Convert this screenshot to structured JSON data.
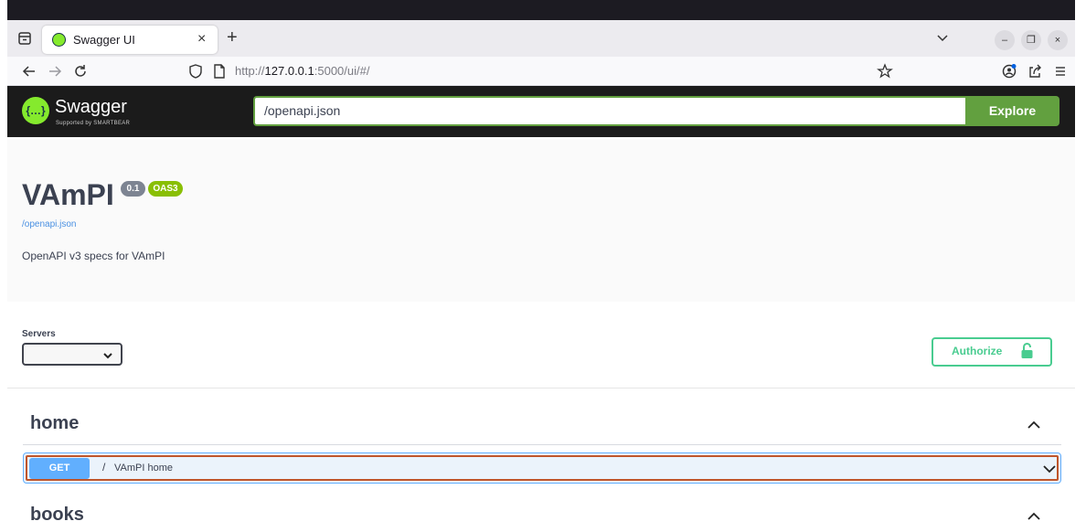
{
  "browser": {
    "tab": {
      "title": "Swagger UI",
      "favicon": "swagger-favicon-icon",
      "close": "×"
    },
    "new_tab": "+",
    "url": {
      "scheme": "http://",
      "host": "127.0.0.1",
      "rest": ":5000/ui/#/"
    },
    "window_controls": {
      "minimize": "–",
      "restore": "❐",
      "close": "×"
    }
  },
  "swagger": {
    "brand": "Swagger",
    "brand_sub": "Supported by SMARTBEAR",
    "spec_url": "/openapi.json",
    "explore_label": "Explore",
    "colors": {
      "topbar": "#1b1b1b",
      "accent_green": "#62a03f",
      "get_blue": "#61affe",
      "authorize_green": "#49cc90"
    }
  },
  "info": {
    "title": "VAmPI",
    "version_badge": "0.1",
    "oas_badge": "OAS3",
    "link": "/openapi.json",
    "description": "OpenAPI v3 specs for VAmPI"
  },
  "servers": {
    "label": "Servers",
    "selected": ""
  },
  "authorize": {
    "label": "Authorize",
    "icon": "lock-open-icon"
  },
  "tags": [
    {
      "name": "home",
      "operations": [
        {
          "method": "GET",
          "path": "/",
          "summary": "VAmPI home"
        }
      ]
    },
    {
      "name": "books",
      "operations": []
    }
  ]
}
